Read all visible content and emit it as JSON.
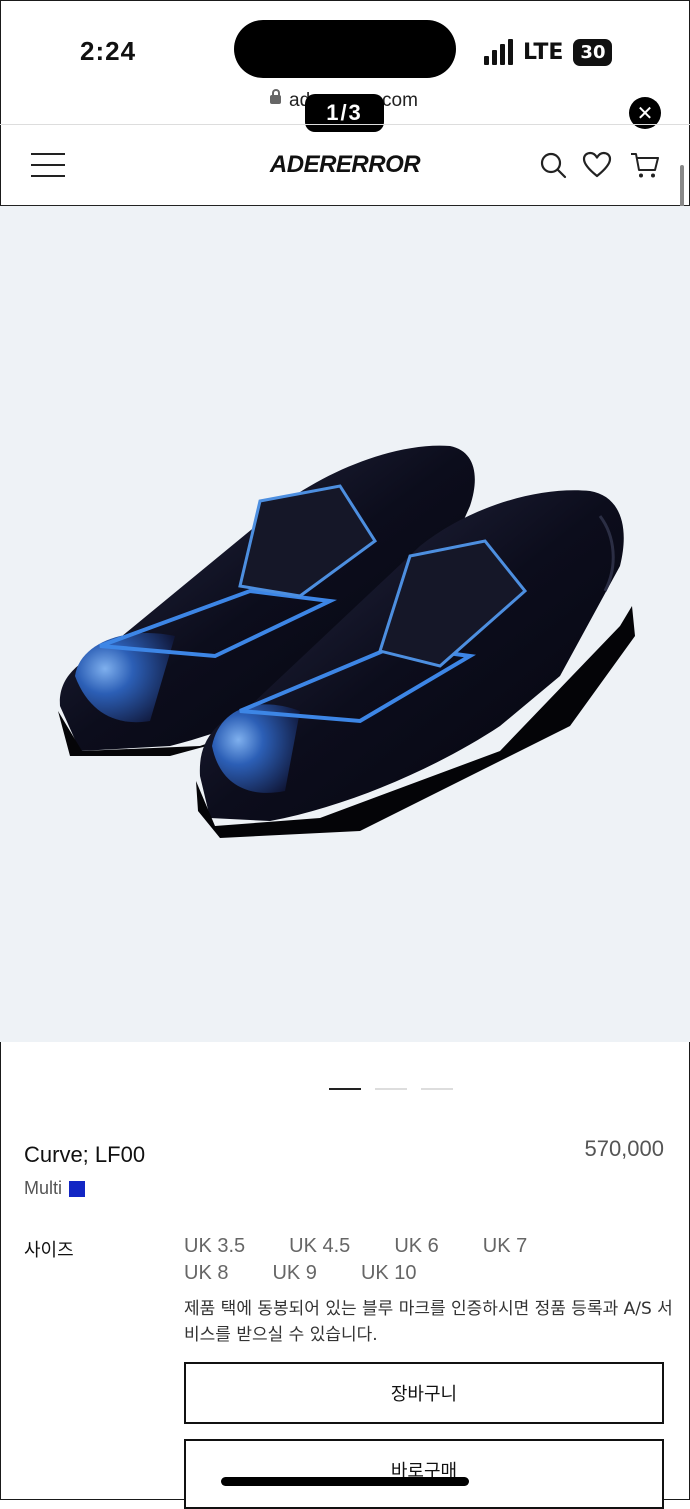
{
  "status_bar": {
    "time": "2:24",
    "network": "LTE",
    "battery": "30"
  },
  "url_bar": {
    "text_start": "ad",
    "text_end": "com",
    "page_indicator": "1/3"
  },
  "header": {
    "logo": "ADERERROR"
  },
  "product": {
    "name": "Curve; LF00",
    "color_label": "Multi",
    "color_hex": "#1226c4",
    "price": "570,000",
    "image_index": 1,
    "image_count": 3
  },
  "size": {
    "label": "사이즈",
    "options": [
      "UK 3.5",
      "UK 4.5",
      "UK 6",
      "UK 7",
      "UK 8",
      "UK 9",
      "UK 10"
    ]
  },
  "notice": "제품 택에 동봉되어 있는 블루 마크를 인증하시면 정품 등록과 A/S 서비스를 받으실 수 있습니다.",
  "buttons": {
    "cart": "장바구니",
    "buy": "바로구매"
  }
}
